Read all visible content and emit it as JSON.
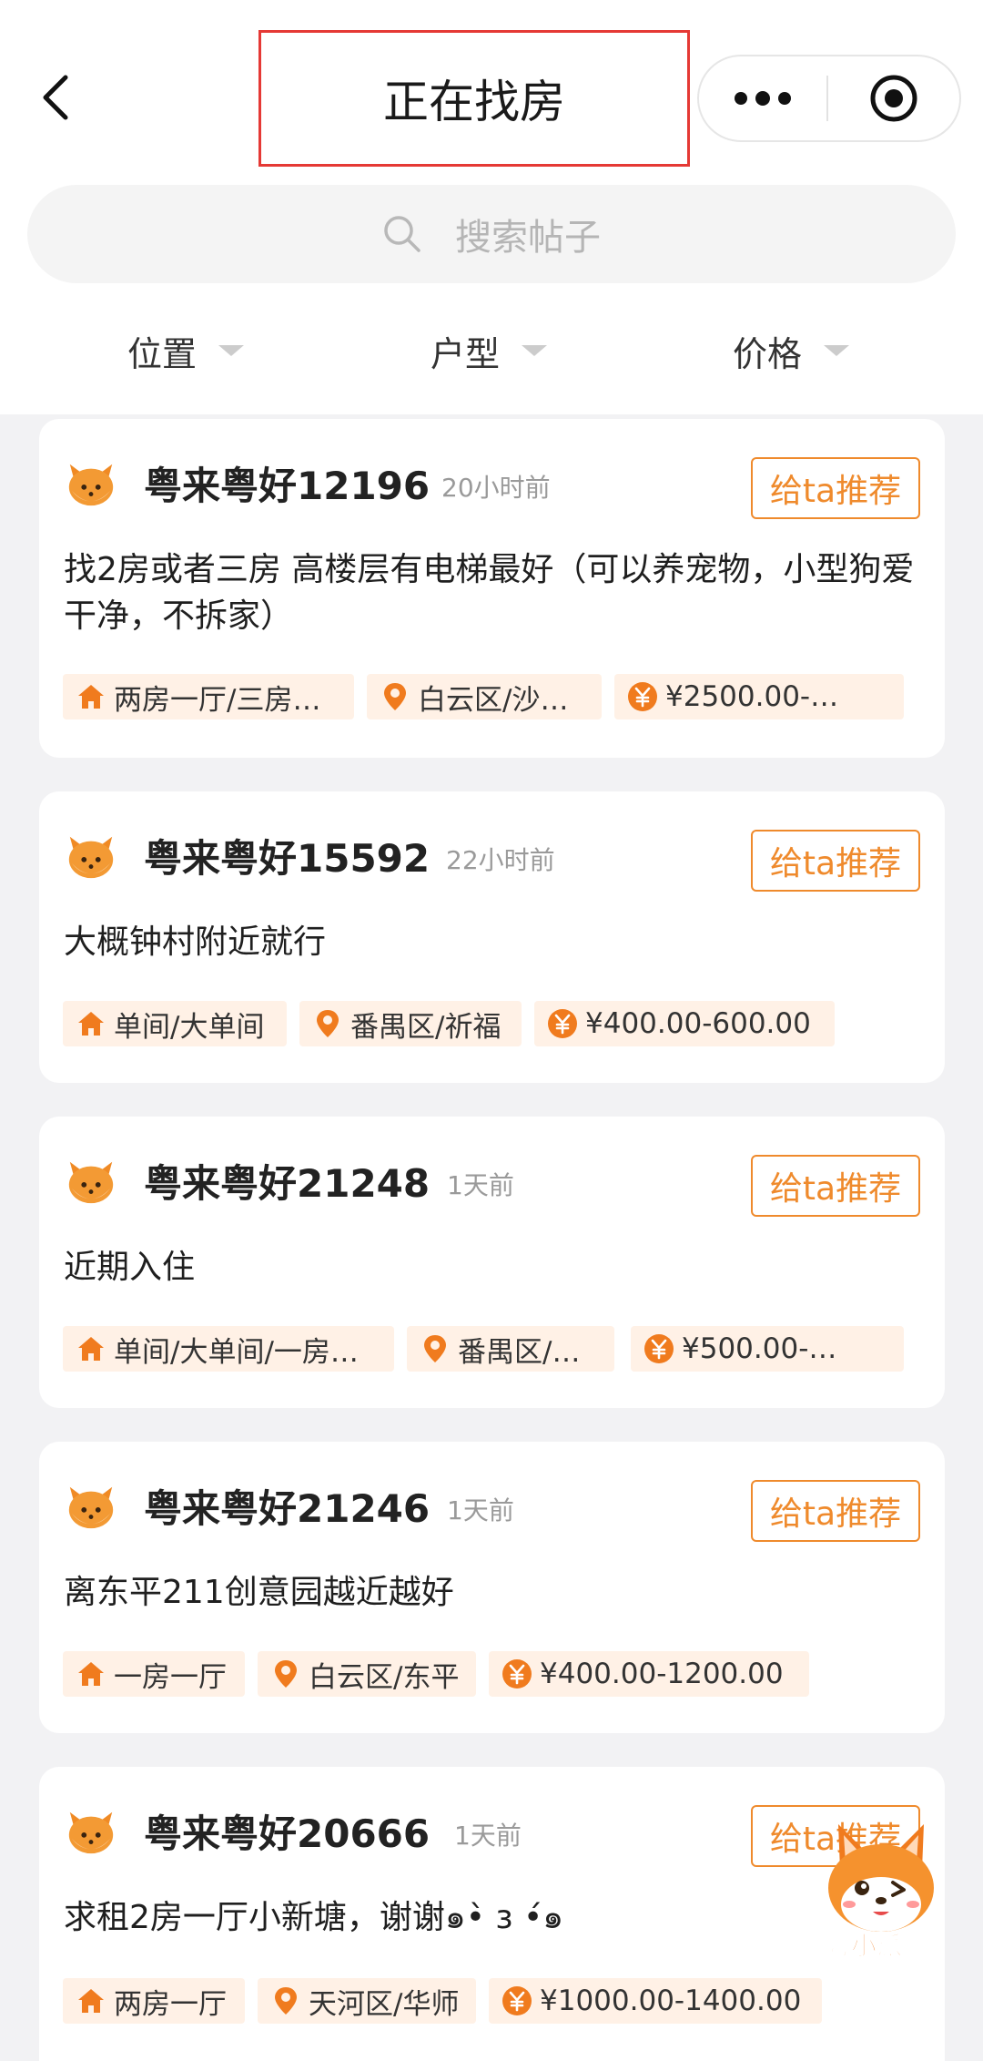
{
  "header": {
    "title": "正在找房",
    "search_placeholder": "搜索帖子",
    "filters": [
      "位置",
      "户型",
      "价格"
    ]
  },
  "posts": [
    {
      "user": "粤来粤好12196",
      "time": "20小时前",
      "button": "给ta推荐",
      "desc": "找2房或者三房 高楼层有电梯最好（可以养宠物，小型狗爱干净，不拆家）",
      "room": "两房一厅/三房…",
      "area": "白云区/沙…",
      "price": "¥2500.00-…"
    },
    {
      "user": "粤来粤好15592",
      "time": "22小时前",
      "button": "给ta推荐",
      "desc": "大概钟村附近就行",
      "room": "单间/大单间",
      "area": "番禺区/祈福",
      "price": "¥400.00-600.00"
    },
    {
      "user": "粤来粤好21248",
      "time": "1天前",
      "button": "给ta推荐",
      "desc": "近期入住",
      "room": "单间/大单间/一房…",
      "area": "番禺区/…",
      "price": "¥500.00-…"
    },
    {
      "user": "粤来粤好21246",
      "time": "1天前",
      "button": "给ta推荐",
      "desc": "离东平211创意园越近越好",
      "room": "一房一厅",
      "area": "白云区/东平",
      "price": "¥400.00-1200.00"
    },
    {
      "user": "粤来粤好20666",
      "time": "1天前",
      "button": "给ta推荐",
      "desc": "求租2房一厅小新塘，谢谢๑•̀ з •́๑",
      "room": "两房一厅",
      "area": "天河区/华师",
      "price": "¥1000.00-1400.00"
    }
  ],
  "mascot": {
    "label": "粤小派"
  },
  "colors": {
    "accent": "#ef8a2c",
    "tag_bg": "#fff1e6",
    "highlight_border": "#e53935"
  },
  "icons": {
    "room": "house-icon",
    "area": "location-pin-icon",
    "price": "yuan-coin-icon"
  }
}
